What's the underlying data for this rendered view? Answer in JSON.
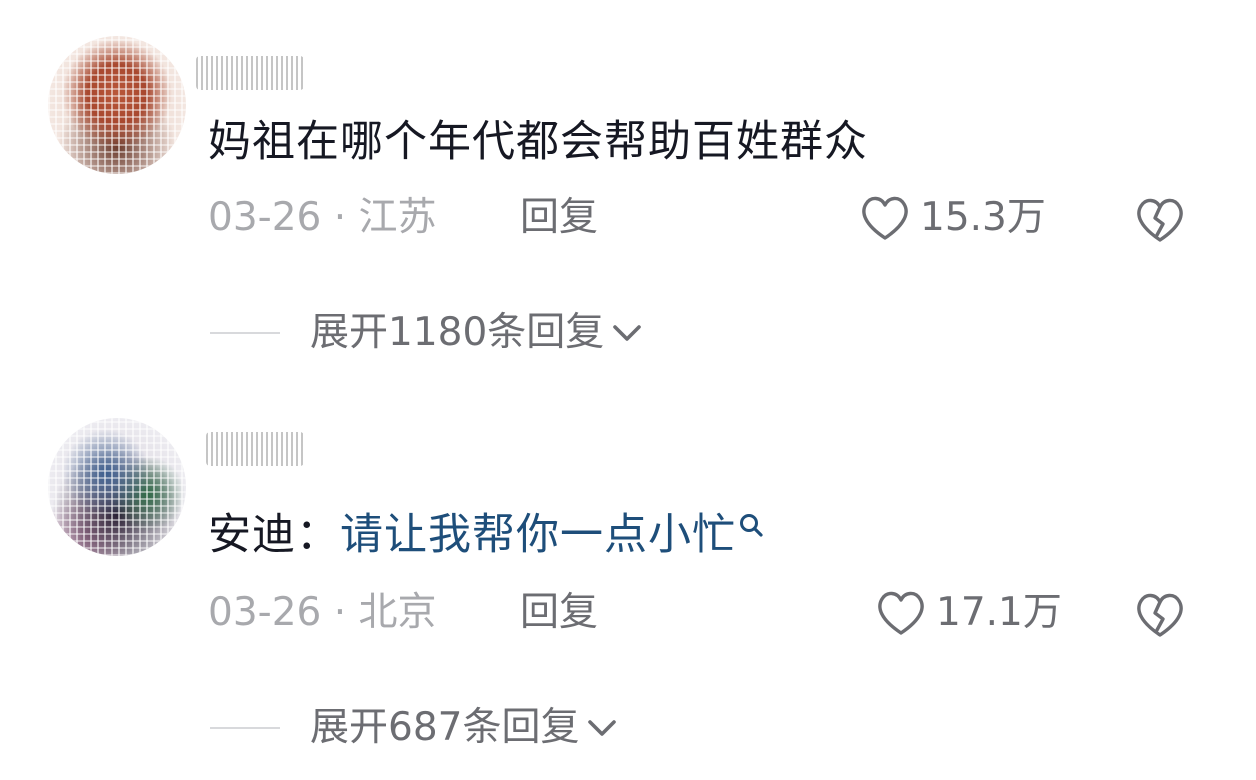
{
  "comments": [
    {
      "text": "妈祖在哪个年代都会帮助百姓群众",
      "date_location": "03-26 · 江苏",
      "reply_label": "回复",
      "likes": "15.3万",
      "expand_label": "展开1180条回复"
    },
    {
      "prefix": "安迪：",
      "mention_text": "请让我帮你一点小忙",
      "date_location": "03-26 · 北京",
      "reply_label": "回复",
      "likes": "17.1万",
      "expand_label": "展开687条回复"
    }
  ],
  "icons": {
    "like": "heart-outline-icon",
    "dislike": "broken-heart-icon",
    "expand": "chevron-down-icon",
    "search": "search-icon"
  },
  "colors": {
    "text_primary": "#161823",
    "text_secondary": "#6c6d72",
    "text_muted": "#a8a9ad",
    "mention": "#1e4e7a",
    "divider": "#d8d9dc"
  }
}
